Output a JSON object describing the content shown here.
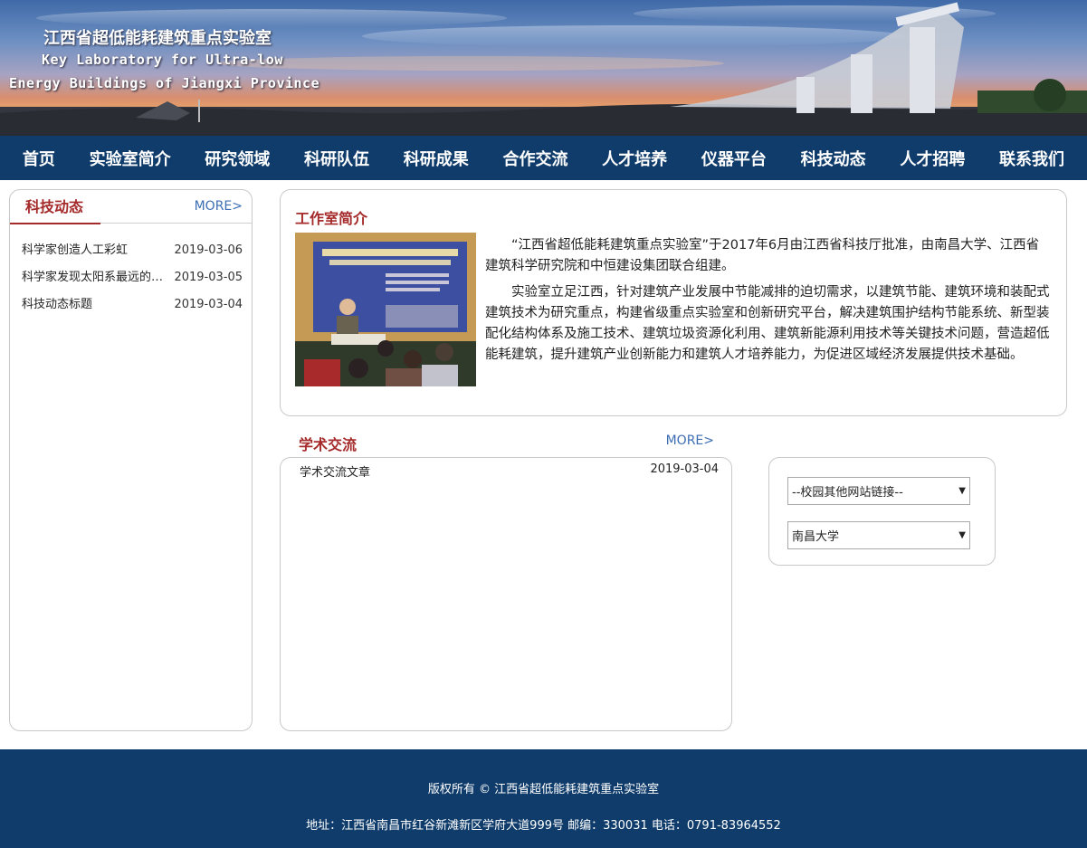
{
  "banner": {
    "title_cn": "江西省超低能耗建筑重点实验室",
    "title_en_line1": "Key Laboratory for Ultra-low",
    "title_en_line2": "Energy Buildings of Jiangxi Province"
  },
  "nav": {
    "items": [
      "首页",
      "实验室简介",
      "研究领域",
      "科研队伍",
      "科研成果",
      "合作交流",
      "人才培养",
      "仪器平台",
      "科技动态",
      "人才招聘",
      "联系我们"
    ]
  },
  "news": {
    "title": "科技动态",
    "more": "MORE>",
    "items": [
      {
        "title": "科学家创造人工彩虹",
        "date": "2019-03-06"
      },
      {
        "title": "科学家发现太阳系最远的天体",
        "date": "2019-03-05"
      },
      {
        "title": "科技动态标题",
        "date": "2019-03-04"
      }
    ]
  },
  "intro": {
    "title": "工作室简介",
    "photo_icon": "conference-photo",
    "paragraphs": [
      "“江西省超低能耗建筑重点实验室”于2017年6月由江西省科技厅批准，由南昌大学、江西省建筑科学研究院和中恒建设集团联合组建。",
      "实验室立足江西，针对建筑产业发展中节能减排的迫切需求，以建筑节能、建筑环境和装配式建筑技术为研究重点，构建省级重点实验室和创新研究平台，解决建筑围护结构节能系统、新型装配化结构体系及施工技术、建筑垃圾资源化利用、建筑新能源利用技术等关键技术问题，营造超低能耗建筑，提升建筑产业创新能力和建筑人才培养能力，为促进区域经济发展提供技术基础。"
    ]
  },
  "academic": {
    "title": "学术交流",
    "more": "MORE>",
    "items": [
      {
        "title": "学术交流文章",
        "date": "2019-03-04"
      }
    ]
  },
  "links": {
    "select1_value": "--校园其他网站链接--",
    "select2_value": "南昌大学"
  },
  "footer": {
    "copyright": "版权所有 © 江西省超低能耗建筑重点实验室",
    "address": "地址：江西省南昌市红谷新滩新区学府大道999号 邮编：330031 电话：0791-83964552"
  },
  "colors": {
    "nav_bg": "#0f3c6b",
    "accent_red": "#a52a2a",
    "more_blue": "#3c6eb4"
  }
}
